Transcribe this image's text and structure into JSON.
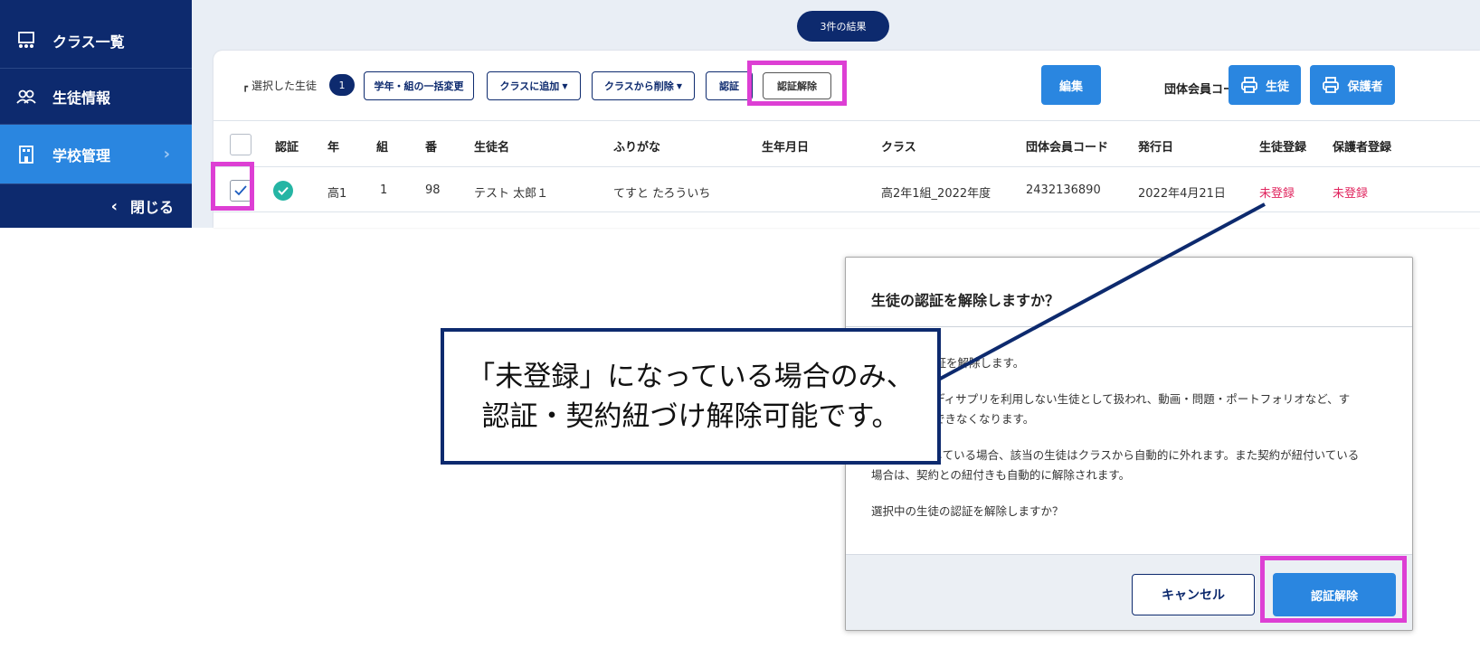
{
  "sidebar": {
    "items": [
      {
        "label": "クラス一覧",
        "icon": "class-list-icon"
      },
      {
        "label": "生徒情報",
        "icon": "students-icon"
      },
      {
        "label": "学校管理",
        "icon": "school-building-icon",
        "active": true
      }
    ],
    "close_label": "閉じる"
  },
  "results": {
    "label": "3件の結果"
  },
  "toolbar": {
    "selected_label": "選択した生徒",
    "selected_count": "1",
    "grade_change": "学年・組の一括変更",
    "add_to_class": "クラスに追加",
    "remove_from_class": "クラスから削除",
    "certify": "認証",
    "uncertify": "認証解除",
    "edit": "編集",
    "print_label": "団体会員コード印刷:",
    "print_student": "生徒",
    "print_guardian": "保護者"
  },
  "table": {
    "headers": [
      "認証",
      "年",
      "組",
      "番",
      "生徒名",
      "ふりがな",
      "生年月日",
      "クラス",
      "団体会員コード",
      "発行日",
      "生徒登録",
      "保護者登録"
    ],
    "rows": [
      {
        "checked": true,
        "certified": true,
        "year": "高1",
        "group": "1",
        "number": "98",
        "name": "テスト 太郎１",
        "kana": "てすと たろういち",
        "birth": "",
        "class": "高2年1組_2022年度",
        "code": "2432136890",
        "issued": "2022年4月21日",
        "student_reg": "未登録",
        "guardian_reg": "未登録"
      }
    ]
  },
  "dialog": {
    "title": "生徒の認証を解除しますか？",
    "p1": "認証を解除します。",
    "p2a": "スタディサプリを利用しない生徒として扱われ、動画・問題・ポートフォリオなど、す",
    "p2b": "利用できなくなります。",
    "p3a": "属している場合、該当の生徒はクラスから自動的に外れます。また契約が紐付いている",
    "p3b": "場合は、契約との紐付きも自動的に解除されます。",
    "p4": "選択中の生徒の認証を解除しますか？",
    "cancel": "キャンセル",
    "confirm": "認証解除"
  },
  "callout": {
    "line1": "「未登録」になっている場合のみ、",
    "line2": "認証・契約紐づけ解除可能です。"
  },
  "colors": {
    "navy": "#0d2a6e",
    "accent": "#2a86e0",
    "highlight": "#dd3fd4",
    "warning": "#e0245e",
    "certified": "#25b5a4"
  }
}
